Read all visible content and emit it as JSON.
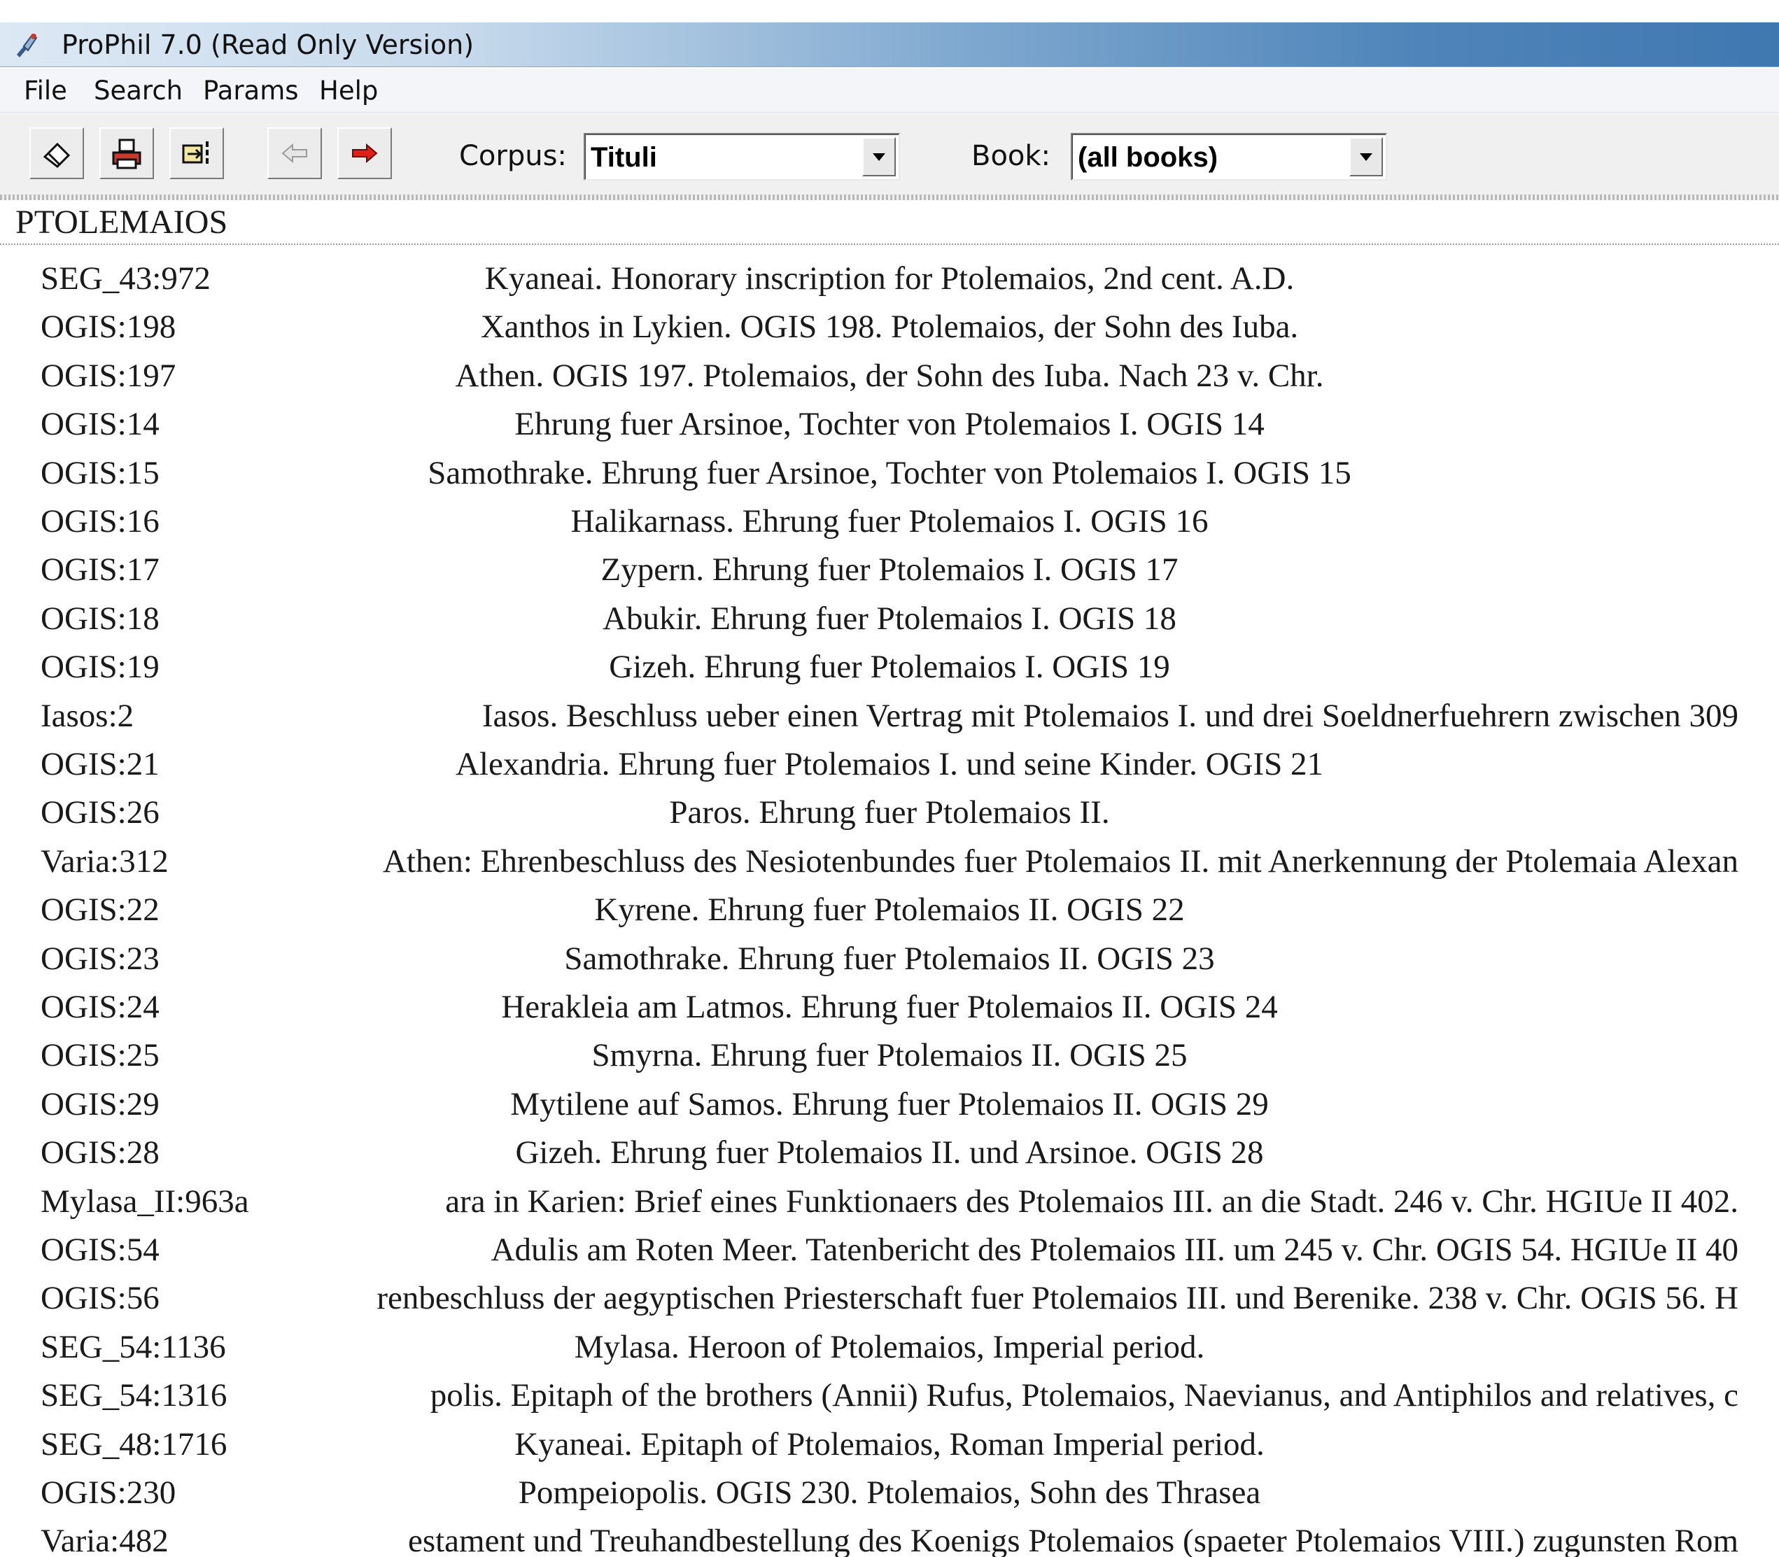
{
  "window": {
    "title": "ProPhil 7.0 (Read Only Version)",
    "title_icon": "prophil-app-icon"
  },
  "menu": [
    "File",
    "Search",
    "Params",
    "Help"
  ],
  "toolbar": {
    "buttons": [
      "eraser-icon",
      "print-icon",
      "export-icon",
      "back-arrow-icon",
      "forward-arrow-icon"
    ],
    "corpus_label": "Corpus:",
    "corpus_value": "Tituli",
    "book_label": "Book:",
    "book_value": "(all books)"
  },
  "results": {
    "heading": "PTOLEMAIOS",
    "rows": [
      {
        "id": "SEG_43:972",
        "desc": "Kyaneai. Honorary inscription for Ptolemaios, 2nd cent. A.D."
      },
      {
        "id": "OGIS:198",
        "desc": "Xanthos in Lykien. OGIS 198. Ptolemaios, der Sohn des Iuba."
      },
      {
        "id": "OGIS:197",
        "desc": "Athen. OGIS 197. Ptolemaios, der Sohn des Iuba. Nach 23 v. Chr."
      },
      {
        "id": "OGIS:14",
        "desc": "Ehrung fuer Arsinoe, Tochter von Ptolemaios I. OGIS 14"
      },
      {
        "id": "OGIS:15",
        "desc": "Samothrake. Ehrung fuer Arsinoe, Tochter von Ptolemaios I. OGIS 15"
      },
      {
        "id": "OGIS:16",
        "desc": "Halikarnass. Ehrung fuer Ptolemaios I. OGIS 16"
      },
      {
        "id": "OGIS:17",
        "desc": "Zypern. Ehrung fuer Ptolemaios I. OGIS 17"
      },
      {
        "id": "OGIS:18",
        "desc": "Abukir. Ehrung fuer Ptolemaios I. OGIS 18"
      },
      {
        "id": "OGIS:19",
        "desc": "Gizeh. Ehrung fuer Ptolemaios I. OGIS 19"
      },
      {
        "id": "Iasos:2",
        "desc": "Iasos. Beschluss ueber einen Vertrag mit Ptolemaios I. und drei Soeldnerfuehrern zwischen 309",
        "wide": true
      },
      {
        "id": "OGIS:21",
        "desc": "Alexandria. Ehrung fuer Ptolemaios I. und seine Kinder. OGIS 21"
      },
      {
        "id": "OGIS:26",
        "desc": "Paros. Ehrung fuer Ptolemaios II."
      },
      {
        "id": "Varia:312",
        "desc": "Athen: Ehrenbeschluss des Nesiotenbundes fuer Ptolemaios II. mit Anerkennung der Ptolemaia Alexan",
        "wide": true
      },
      {
        "id": "OGIS:22",
        "desc": "Kyrene. Ehrung fuer Ptolemaios II. OGIS 22"
      },
      {
        "id": "OGIS:23",
        "desc": "Samothrake. Ehrung fuer Ptolemaios II. OGIS 23"
      },
      {
        "id": "OGIS:24",
        "desc": "Herakleia am Latmos. Ehrung fuer Ptolemaios II. OGIS 24"
      },
      {
        "id": "OGIS:25",
        "desc": "Smyrna. Ehrung fuer Ptolemaios II. OGIS 25"
      },
      {
        "id": "OGIS:29",
        "desc": "Mytilene auf Samos. Ehrung fuer Ptolemaios II. OGIS 29"
      },
      {
        "id": "OGIS:28",
        "desc": "Gizeh. Ehrung fuer Ptolemaios II. und Arsinoe. OGIS 28"
      },
      {
        "id": "Mylasa_II:963a",
        "desc": "ara in Karien: Brief eines Funktionaers des Ptolemaios III. an die Stadt. 246 v. Chr. HGIUe II 402.",
        "wide": true
      },
      {
        "id": "OGIS:54",
        "desc": "Adulis am Roten Meer. Tatenbericht des Ptolemaios III. um 245 v. Chr. OGIS 54. HGIUe II 40",
        "wide": true
      },
      {
        "id": "OGIS:56",
        "desc": "renbeschluss der aegyptischen Priesterschaft fuer Ptolemaios III. und Berenike. 238 v. Chr. OGIS 56. H",
        "wide": true
      },
      {
        "id": "SEG_54:1136",
        "desc": "Mylasa. Heroon of Ptolemaios, Imperial period."
      },
      {
        "id": "SEG_54:1316",
        "desc": "polis. Epitaph of the brothers (Annii) Rufus,  Ptolemaios, Naevianus, and Antiphilos and relatives, c",
        "wide": true
      },
      {
        "id": "SEG_48:1716",
        "desc": "Kyaneai. Epitaph of Ptolemaios, Roman Imperial  period."
      },
      {
        "id": "OGIS:230",
        "desc": "Pompeiopolis. OGIS 230. Ptolemaios, Sohn des Thrasea"
      },
      {
        "id": "Varia:482",
        "desc": "estament und Treuhandbestellung des Koenigs Ptolemaios (spaeter Ptolemaios VIII.) zugunsten Rom",
        "wide": true
      }
    ]
  }
}
